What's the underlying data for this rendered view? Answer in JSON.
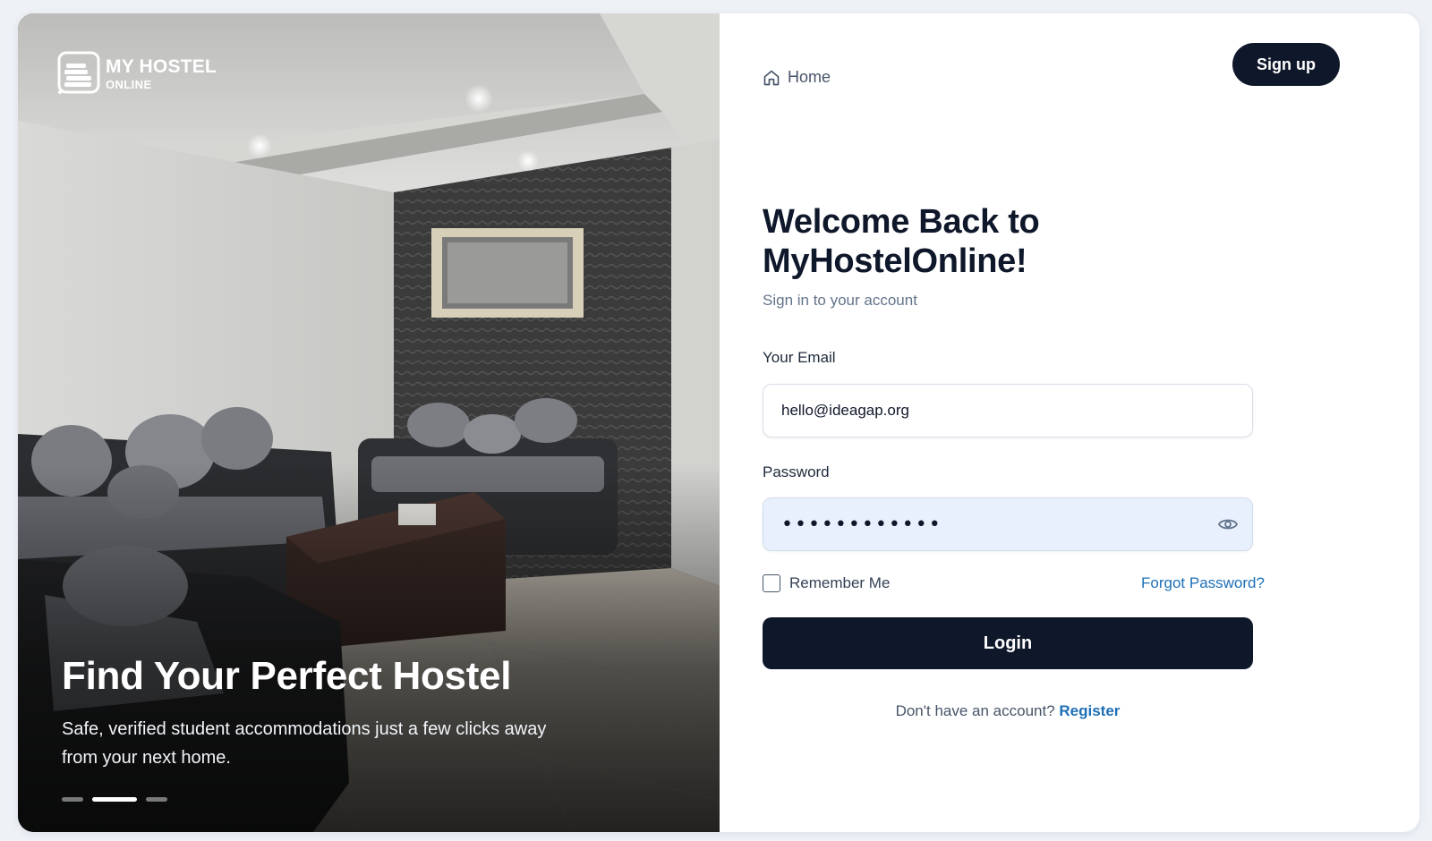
{
  "brand": {
    "line1": "MY HOSTEL",
    "line2": "ONLINE"
  },
  "hero": {
    "title": "Find Your Perfect Hostel",
    "subtitle": "Safe, verified student accommodations just a few clicks away from your next home.",
    "carousel": {
      "slide_count": 3,
      "active_index": 1
    }
  },
  "nav": {
    "home_label": "Home",
    "signup_label": "Sign up"
  },
  "form": {
    "heading_line1": "Welcome Back to",
    "heading_line2": "MyHostelOnline!",
    "subheading": "Sign in to your account",
    "email_label": "Your Email",
    "email_value": "hello@ideagap.org",
    "password_label": "Password",
    "password_masked": "••••••••••••",
    "remember_label": "Remember Me",
    "remember_checked": false,
    "forgot_label": "Forgot Password?",
    "login_label": "Login",
    "register_prompt": "Don't have an account?",
    "register_label": "Register"
  },
  "icons": {
    "home": "home-icon",
    "eye": "eye-icon",
    "logo": "hostel-logo-icon"
  },
  "colors": {
    "primary_dark": "#0f172a",
    "link_blue": "#1d6fb8",
    "page_bg": "#eef2f7",
    "password_bg": "#e8f0fe"
  }
}
